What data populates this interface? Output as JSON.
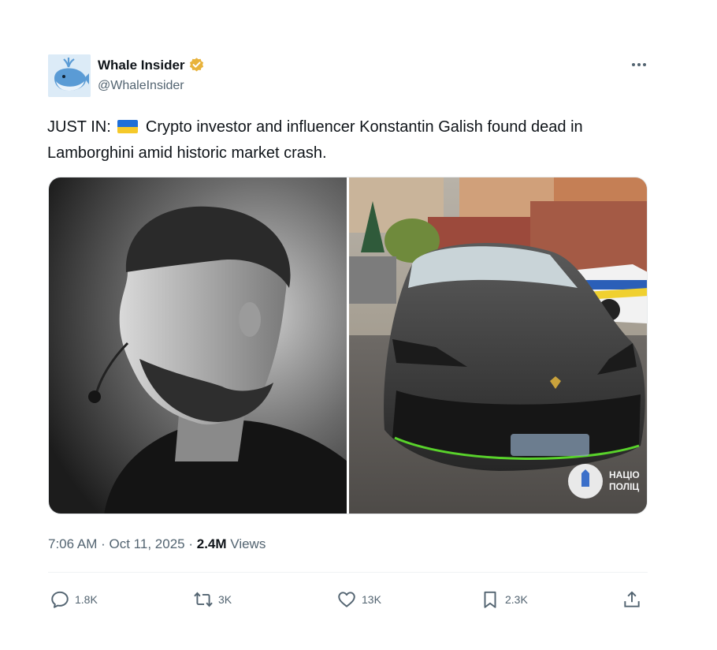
{
  "author": {
    "display_name": "Whale Insider",
    "handle": "@WhaleInsider",
    "verified_color": "#e8b33c",
    "avatar_icon": "whale-logo"
  },
  "more_icon": "more-dots-icon",
  "tweet": {
    "prefix": "JUST IN:",
    "flag_icon": "ukraine-flag-icon",
    "text": "Crypto investor and influencer Konstantin Galish found dead in Lamborghini amid historic market crash."
  },
  "media": {
    "left": {
      "alt": "black-and-white portrait photo",
      "icon": "portrait-photo"
    },
    "right": {
      "alt": "photo of black Lamborghini Urus parked near police car",
      "icon": "car-photo",
      "watermark": "НАЦІО ПОЛІЦ"
    }
  },
  "meta": {
    "time": "7:06 AM",
    "sep1": "·",
    "date": "Oct 11, 2025",
    "sep2": "·",
    "views_count": "2.4M",
    "views_label": "Views"
  },
  "actions": {
    "reply": {
      "count": "1.8K",
      "icon": "reply-icon"
    },
    "retweet": {
      "count": "3K",
      "icon": "retweet-icon"
    },
    "like": {
      "count": "13K",
      "icon": "heart-icon"
    },
    "bookmark": {
      "count": "2.3K",
      "icon": "bookmark-icon"
    },
    "share": {
      "icon": "share-icon"
    }
  },
  "colors": {
    "text": "#0f1419",
    "secondary": "#536471",
    "divider": "#eff3f4"
  }
}
